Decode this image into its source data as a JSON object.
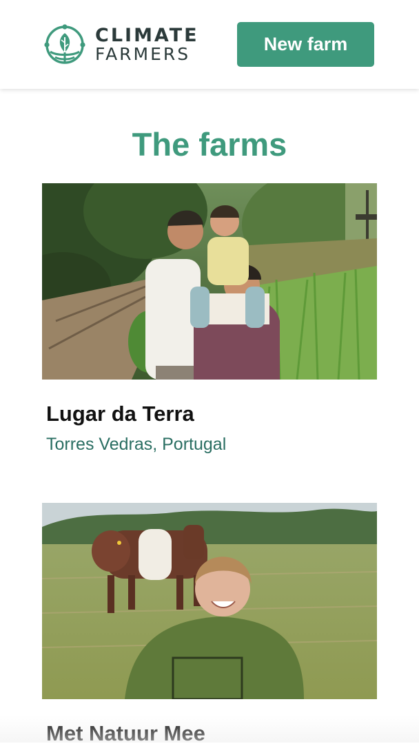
{
  "header": {
    "logo": {
      "line1": "CLIMATE",
      "line2": "FARMERS",
      "icon": "leaf-globe-logo-icon",
      "color": "#3f9a7d"
    },
    "new_farm_label": "New farm"
  },
  "page_title": "The farms",
  "colors": {
    "accent": "#3f9a7d",
    "location_text": "#2a6e62",
    "farm_name_text": "#111111"
  },
  "farms": [
    {
      "name": "Lugar da Terra",
      "location": "Torres Vedras, Portugal",
      "photo": "family-in-garden-photo"
    },
    {
      "name": "Met Natuur Mee",
      "photo": "farmer-with-cow-photo"
    }
  ]
}
